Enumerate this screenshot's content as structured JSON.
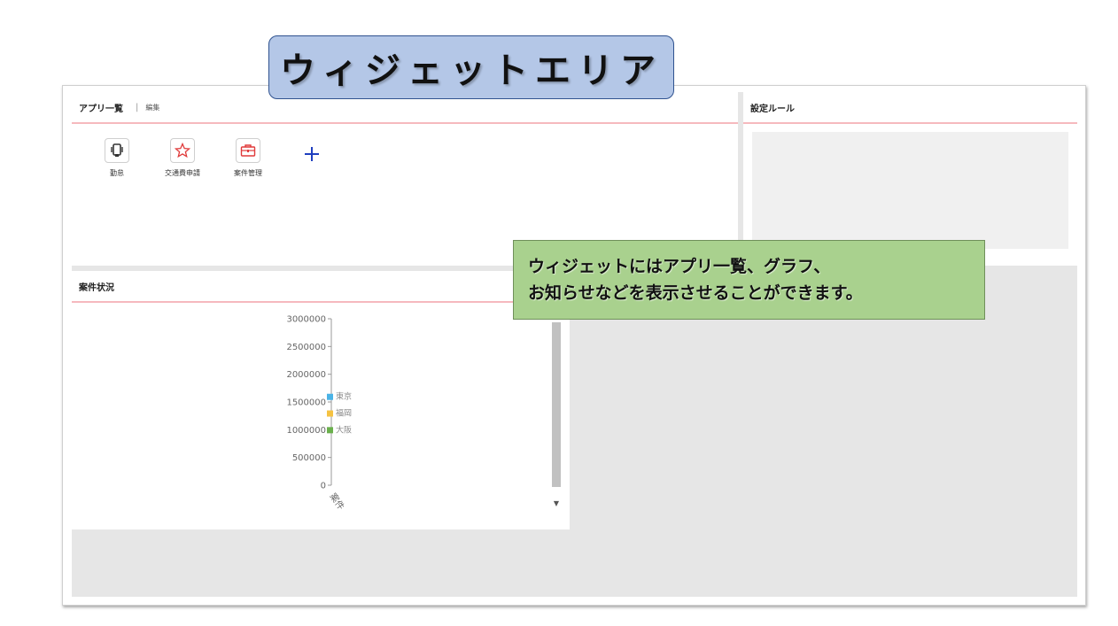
{
  "title_callout": "ウィジェットエリア",
  "description_callout": {
    "line1": "ウィジェットにはアプリ一覧、グラフ、",
    "line2": "お知らせなどを表示させることができます。"
  },
  "apps_panel": {
    "title": "アプリ一覧",
    "separator": "|",
    "edit_label": "編集",
    "apps": [
      {
        "label": "勤怠",
        "icon": "phone-icon",
        "color": "#333333"
      },
      {
        "label": "交通費申請",
        "icon": "star-icon",
        "color": "#e03a3a"
      },
      {
        "label": "案件管理",
        "icon": "briefcase-icon",
        "color": "#e03a3a"
      }
    ],
    "add_icon": "plus-icon",
    "add_color": "#1f3fbf"
  },
  "rules_panel": {
    "title": "設定ルール"
  },
  "projects_panel": {
    "title": "案件状況"
  },
  "chart_data": {
    "type": "bar",
    "categories": [
      "案件"
    ],
    "series": [
      {
        "name": "東京",
        "values": [
          1600000
        ],
        "color": "#4ab3e6"
      },
      {
        "name": "福岡",
        "values": [
          1300000
        ],
        "color": "#f5c242"
      },
      {
        "name": "大阪",
        "values": [
          1000000
        ],
        "color": "#6ab04c"
      }
    ],
    "y_ticks": [
      "3000000",
      "2500000",
      "2000000",
      "1500000",
      "1000000",
      "500000",
      "0"
    ],
    "ylim": [
      0,
      3000000
    ],
    "legend_position": "inline-right"
  }
}
